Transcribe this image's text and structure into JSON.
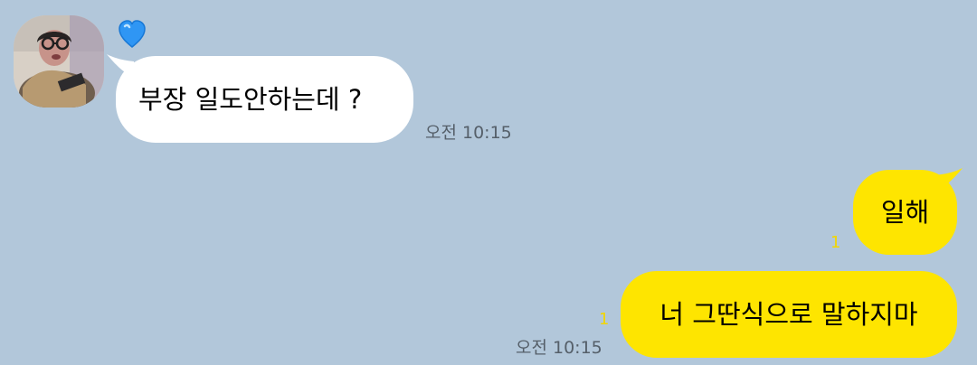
{
  "chat": {
    "incoming": {
      "icon": "blue-heart-icon",
      "message": "부장 일도안하는데 ?",
      "time": "오전 10:15"
    },
    "outgoing": [
      {
        "message": "일해",
        "unread": "1"
      },
      {
        "message": "너 그딴식으로 말하지마",
        "unread": "1",
        "time": "오전 10:15"
      }
    ]
  },
  "colors": {
    "background": "#b2c7da",
    "incoming_bubble": "#ffffff",
    "outgoing_bubble": "#fee500",
    "unread_count": "#f2d600",
    "timestamp": "#555f69"
  }
}
